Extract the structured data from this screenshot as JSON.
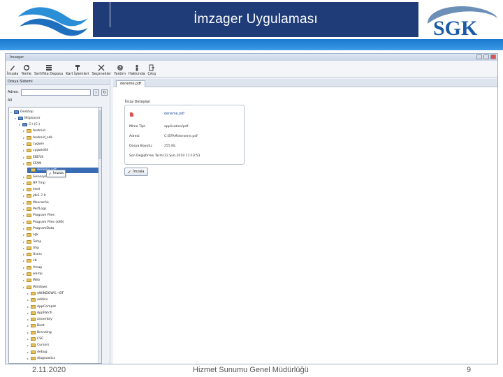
{
  "header": {
    "title": "İmzager Uygulaması",
    "logo_left": "ssk-wave-logo",
    "logo_right_text": "SGK",
    "colors": {
      "title_box": "#1f3c78",
      "strip": "#2a86db",
      "sgk_blue": "#1b5aa6"
    }
  },
  "window": {
    "title": "İmzager",
    "toolbar": [
      {
        "label": "İmzala",
        "icon": "pen-icon"
      },
      {
        "label": "Yenile",
        "icon": "refresh-icon"
      },
      {
        "label": "Sertifika Deposu",
        "icon": "certificate-store-icon"
      },
      {
        "label": "Kart İşlemleri",
        "icon": "card-icon"
      },
      {
        "label": "Seçenekler",
        "icon": "tools-icon"
      },
      {
        "label": "Yardım",
        "icon": "help-icon"
      },
      {
        "label": "Hakkında",
        "icon": "info-icon"
      },
      {
        "label": "Çıkış",
        "icon": "exit-icon"
      }
    ]
  },
  "left_panel": {
    "tab": "Dosya Sistemi",
    "address_label": "Adres:",
    "all_label": "All",
    "tree": [
      {
        "label": "Desktop",
        "indent": 0,
        "pc": true
      },
      {
        "label": "Bilgisayar",
        "indent": 1,
        "pc": true
      },
      {
        "label": "C:\\ (C:)",
        "indent": 2,
        "pc": true
      },
      {
        "label": "Android",
        "indent": 3
      },
      {
        "label": "Android_sdk",
        "indent": 3
      },
      {
        "label": "cygwin",
        "indent": 3
      },
      {
        "label": "cygwin64",
        "indent": 3
      },
      {
        "label": "EBEVS",
        "indent": 3
      },
      {
        "label": "EFAM",
        "indent": 3
      },
      {
        "label": "deneme.pdf",
        "indent": 4,
        "selected": true
      },
      {
        "label": "Genesys",
        "indent": 3
      },
      {
        "label": "HP Tmp",
        "indent": 3
      },
      {
        "label": "Intel",
        "indent": 3
      },
      {
        "label": "jdk1.7.0",
        "indent": 3
      },
      {
        "label": "Msocache",
        "indent": 3
      },
      {
        "label": "PerfLogs",
        "indent": 3
      },
      {
        "label": "Program Files",
        "indent": 3
      },
      {
        "label": "Program Files (x86)",
        "indent": 3
      },
      {
        "label": "ProgramData",
        "indent": 3
      },
      {
        "label": "sgk",
        "indent": 3
      },
      {
        "label": "Temp",
        "indent": 3
      },
      {
        "label": "tmp",
        "indent": 3
      },
      {
        "label": "Users",
        "indent": 3
      },
      {
        "label": "vb",
        "indent": 3
      },
      {
        "label": "Vmap",
        "indent": 3
      },
      {
        "label": "wamp",
        "indent": 3
      },
      {
        "label": "Web",
        "indent": 3
      },
      {
        "label": "Windows",
        "indent": 3
      },
      {
        "label": "$WINDOWS.~BT",
        "indent": 4
      },
      {
        "label": "addins",
        "indent": 4
      },
      {
        "label": "AppCompat",
        "indent": 4
      },
      {
        "label": "AppPatch",
        "indent": 4
      },
      {
        "label": "assembly",
        "indent": 4
      },
      {
        "label": "Boot",
        "indent": 4
      },
      {
        "label": "Branding",
        "indent": 4
      },
      {
        "label": "CSC",
        "indent": 4
      },
      {
        "label": "Cursors",
        "indent": 4
      },
      {
        "label": "debug",
        "indent": 4
      },
      {
        "label": "diagnostics",
        "indent": 4
      }
    ],
    "context_menu": "İmzala"
  },
  "right_panel": {
    "tab": "deneme.pdf",
    "section_title": "İmza Detayları",
    "file_name": "deneme.pdf",
    "details": [
      {
        "label": "Mime Tipi:",
        "value": "application/pdf"
      },
      {
        "label": "Adresi:",
        "value": "C:\\EFAM\\deneme.pdf"
      },
      {
        "label": "Dosya Boyutu:",
        "value": "255 Kb"
      },
      {
        "label": "Son Değiştirme Tarihi:",
        "value": "12.Şub.2019 11:10:53"
      }
    ],
    "sign_button": "İmzala"
  },
  "footer": {
    "date": "2.11.2020",
    "center": "Hizmet Sunumu Genel Müdürlüğü",
    "page": "9"
  }
}
